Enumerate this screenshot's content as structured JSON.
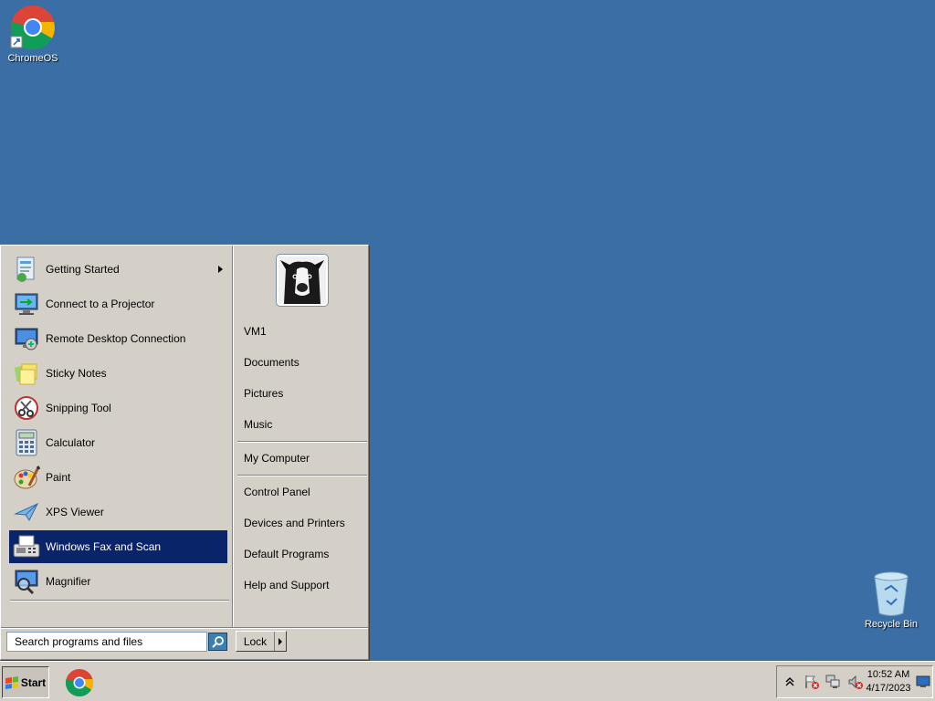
{
  "desktop": {
    "icons": [
      {
        "label": "ChromeOS",
        "icon": "chrome-icon"
      },
      {
        "label": "Recycle Bin",
        "icon": "recycle-bin-icon"
      }
    ]
  },
  "start_menu": {
    "programs": [
      {
        "label": "Getting Started",
        "icon": "getting-started-icon",
        "has_submenu": true
      },
      {
        "label": "Connect to a Projector",
        "icon": "projector-icon"
      },
      {
        "label": "Remote Desktop Connection",
        "icon": "remote-desktop-icon"
      },
      {
        "label": "Sticky Notes",
        "icon": "sticky-notes-icon"
      },
      {
        "label": "Snipping Tool",
        "icon": "scissors-icon"
      },
      {
        "label": "Calculator",
        "icon": "calculator-icon"
      },
      {
        "label": "Paint",
        "icon": "paint-palette-icon"
      },
      {
        "label": "XPS Viewer",
        "icon": "xps-viewer-icon"
      },
      {
        "label": "Windows Fax and Scan",
        "icon": "fax-icon",
        "selected": true
      },
      {
        "label": "Magnifier",
        "icon": "magnifier-icon"
      }
    ],
    "right": {
      "group1": [
        "VM1",
        "Documents",
        "Pictures",
        "Music"
      ],
      "group2": [
        "My Computer"
      ],
      "group3": [
        "Control Panel",
        "Devices and Printers",
        "Default Programs",
        "Help and Support"
      ]
    },
    "search": {
      "placeholder": "Search programs and files",
      "value": "Search programs and files"
    },
    "lock_label": "Lock"
  },
  "taskbar": {
    "start_label": "Start",
    "pinned": [
      {
        "icon": "chrome-icon"
      }
    ],
    "clock": {
      "time": "10:52 AM",
      "date": "4/17/2023"
    }
  },
  "colors": {
    "desktop_bg": "#3b6ea5",
    "menu_bg": "#d4d0c8",
    "selection": "#0a246a"
  }
}
